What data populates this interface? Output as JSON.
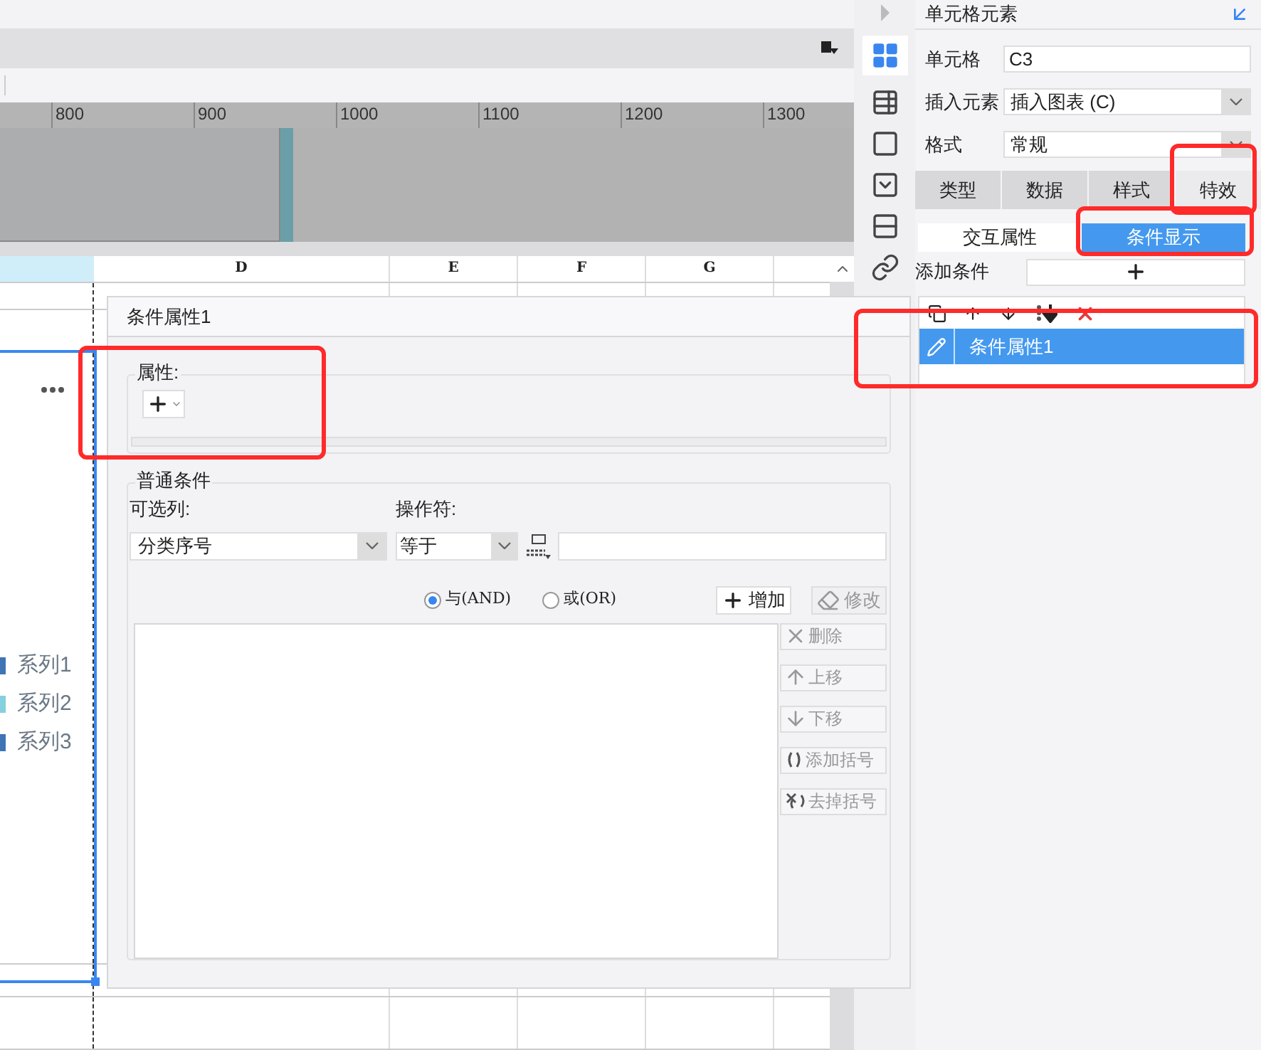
{
  "ruler": {
    "labels": [
      "800",
      "900",
      "1000",
      "1100",
      "1200",
      "1300"
    ]
  },
  "sheet": {
    "columns": [
      "D",
      "E",
      "F",
      "G"
    ],
    "legend": [
      {
        "label": "系列1",
        "color": "#3f74b5"
      },
      {
        "label": "系列2",
        "color": "#84d0df"
      },
      {
        "label": "系列3",
        "color": "#3f74b5"
      }
    ]
  },
  "panel": {
    "title": "单元格元素",
    "fields": [
      {
        "label": "单元格",
        "value": "C3",
        "kind": "input"
      },
      {
        "label": "插入元素",
        "value": "插入图表 (C)",
        "kind": "select"
      },
      {
        "label": "格式",
        "value": "常规",
        "kind": "select"
      }
    ],
    "tabs": [
      {
        "label": "类型",
        "selected": false
      },
      {
        "label": "数据",
        "selected": false
      },
      {
        "label": "样式",
        "selected": false
      },
      {
        "label": "特效",
        "selected": true
      }
    ],
    "subtabs": [
      {
        "label": "交互属性",
        "selected": false
      },
      {
        "label": "条件显示",
        "selected": true
      }
    ],
    "add_condition": {
      "label": "添加条件"
    },
    "conditions": {
      "items": [
        {
          "label": "条件属性1",
          "selected": true
        }
      ]
    }
  },
  "dialog": {
    "title": "条件属性1",
    "attributes": {
      "legend": "属性:"
    },
    "normal": {
      "legend": "普通条件",
      "column_label": "可选列:",
      "column_value": "分类序号",
      "operator_label": "操作符:",
      "operator_value": "等于",
      "radios": [
        {
          "label": "与(AND)",
          "selected": true
        },
        {
          "label": "或(OR)",
          "selected": false
        }
      ],
      "buttons": [
        {
          "label": "增加",
          "kind": "add",
          "disabled": false
        },
        {
          "label": "修改",
          "kind": "edit",
          "disabled": true
        }
      ],
      "side_buttons": [
        {
          "label": "删除",
          "kind": "delete",
          "disabled": true
        },
        {
          "label": "上移",
          "kind": "up",
          "disabled": true
        },
        {
          "label": "下移",
          "kind": "down",
          "disabled": true
        },
        {
          "label": "添加括号",
          "kind": "add-paren",
          "disabled": true
        },
        {
          "label": "去掉括号",
          "kind": "remove-paren",
          "disabled": true
        }
      ]
    }
  },
  "annotations": [
    {
      "kind": "red-frame"
    },
    {
      "kind": "red-frame"
    },
    {
      "kind": "red-frame"
    },
    {
      "kind": "red-frame"
    }
  ]
}
